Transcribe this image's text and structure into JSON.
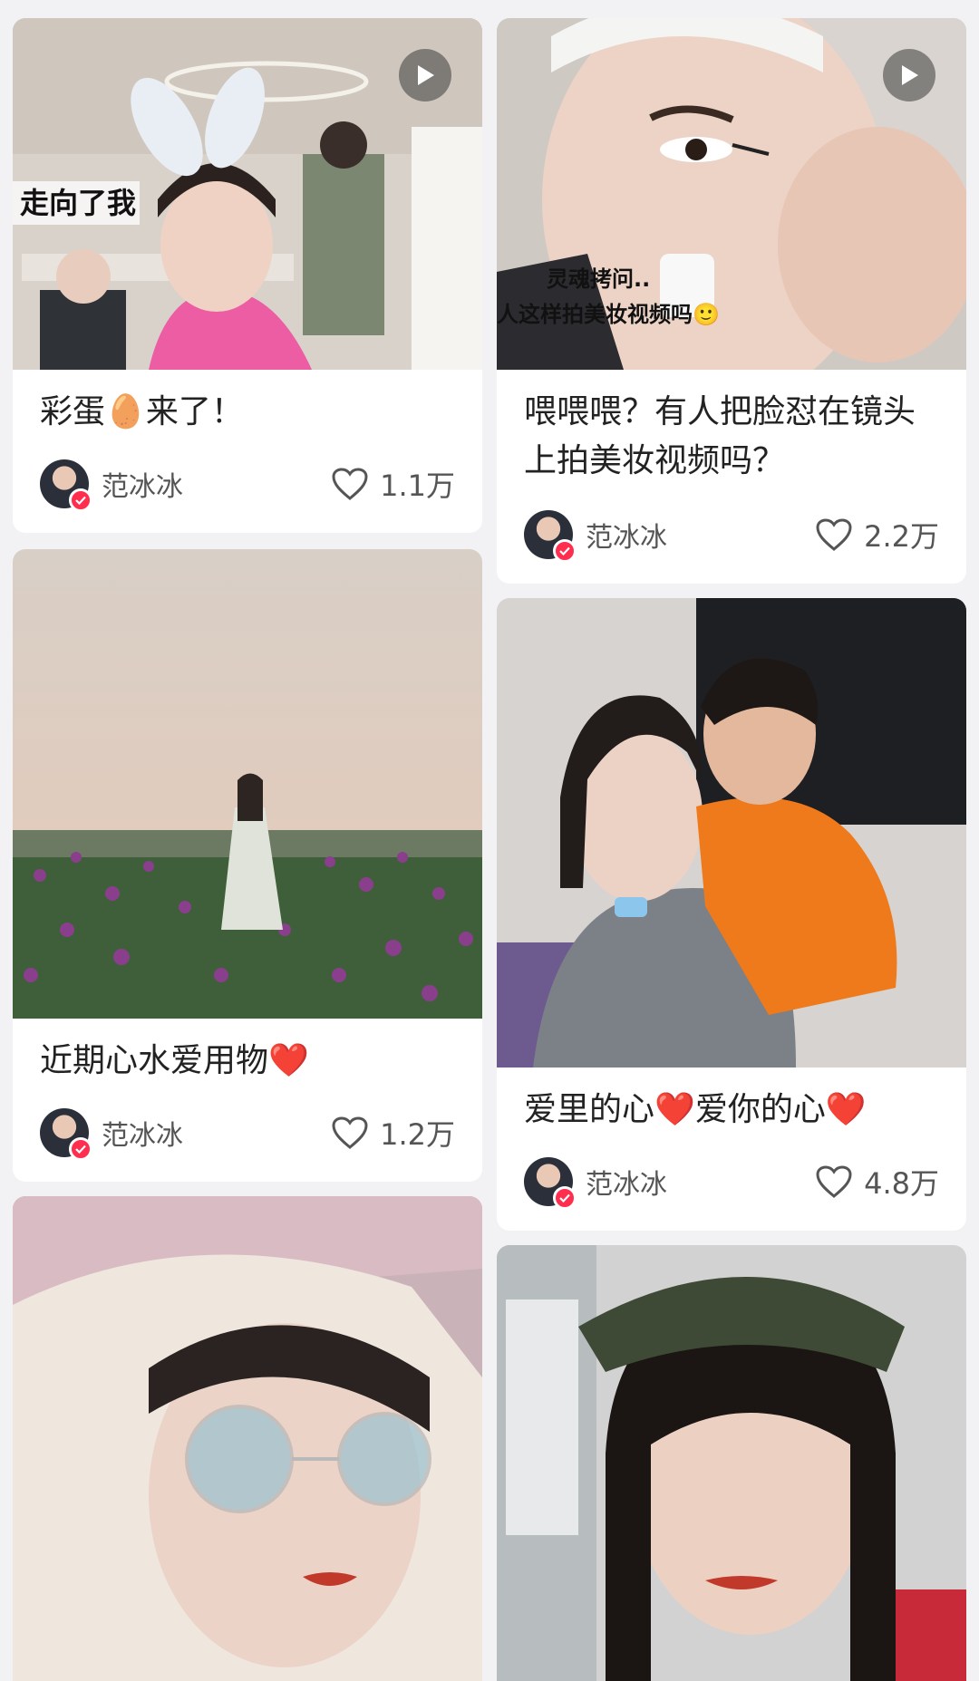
{
  "feed": {
    "cards": [
      {
        "title": "彩蛋🥚来了！",
        "author": "范冰冰",
        "likes": "1.1万",
        "is_video": true,
        "overlay_text": "走向了我"
      },
      {
        "title": "喂喂喂？有人把脸怼在镜头上拍美妆视频吗？",
        "author": "范冰冰",
        "likes": "2.2万",
        "is_video": true,
        "overlay_text_1": "灵魂拷问..",
        "overlay_text_2": "人这样拍美妆视频吗🙂"
      },
      {
        "title": "近期心水爱用物❤️",
        "author": "范冰冰",
        "likes": "1.2万",
        "is_video": false
      },
      {
        "title": "爱里的心❤️爱你的心❤️",
        "author": "范冰冰",
        "likes": "4.8万",
        "is_video": false
      },
      {
        "title": "",
        "author": "",
        "likes": "",
        "is_video": false
      },
      {
        "title": "",
        "author": "",
        "likes": "",
        "is_video": false
      }
    ]
  },
  "icons": {
    "play": "play-icon",
    "heart": "heart-outline-icon",
    "verified": "verified-badge-icon"
  },
  "colors": {
    "background": "#f2f2f4",
    "card": "#ffffff",
    "title_text": "#222222",
    "meta_text": "#555555",
    "verified_badge": "#ff2d4e"
  }
}
